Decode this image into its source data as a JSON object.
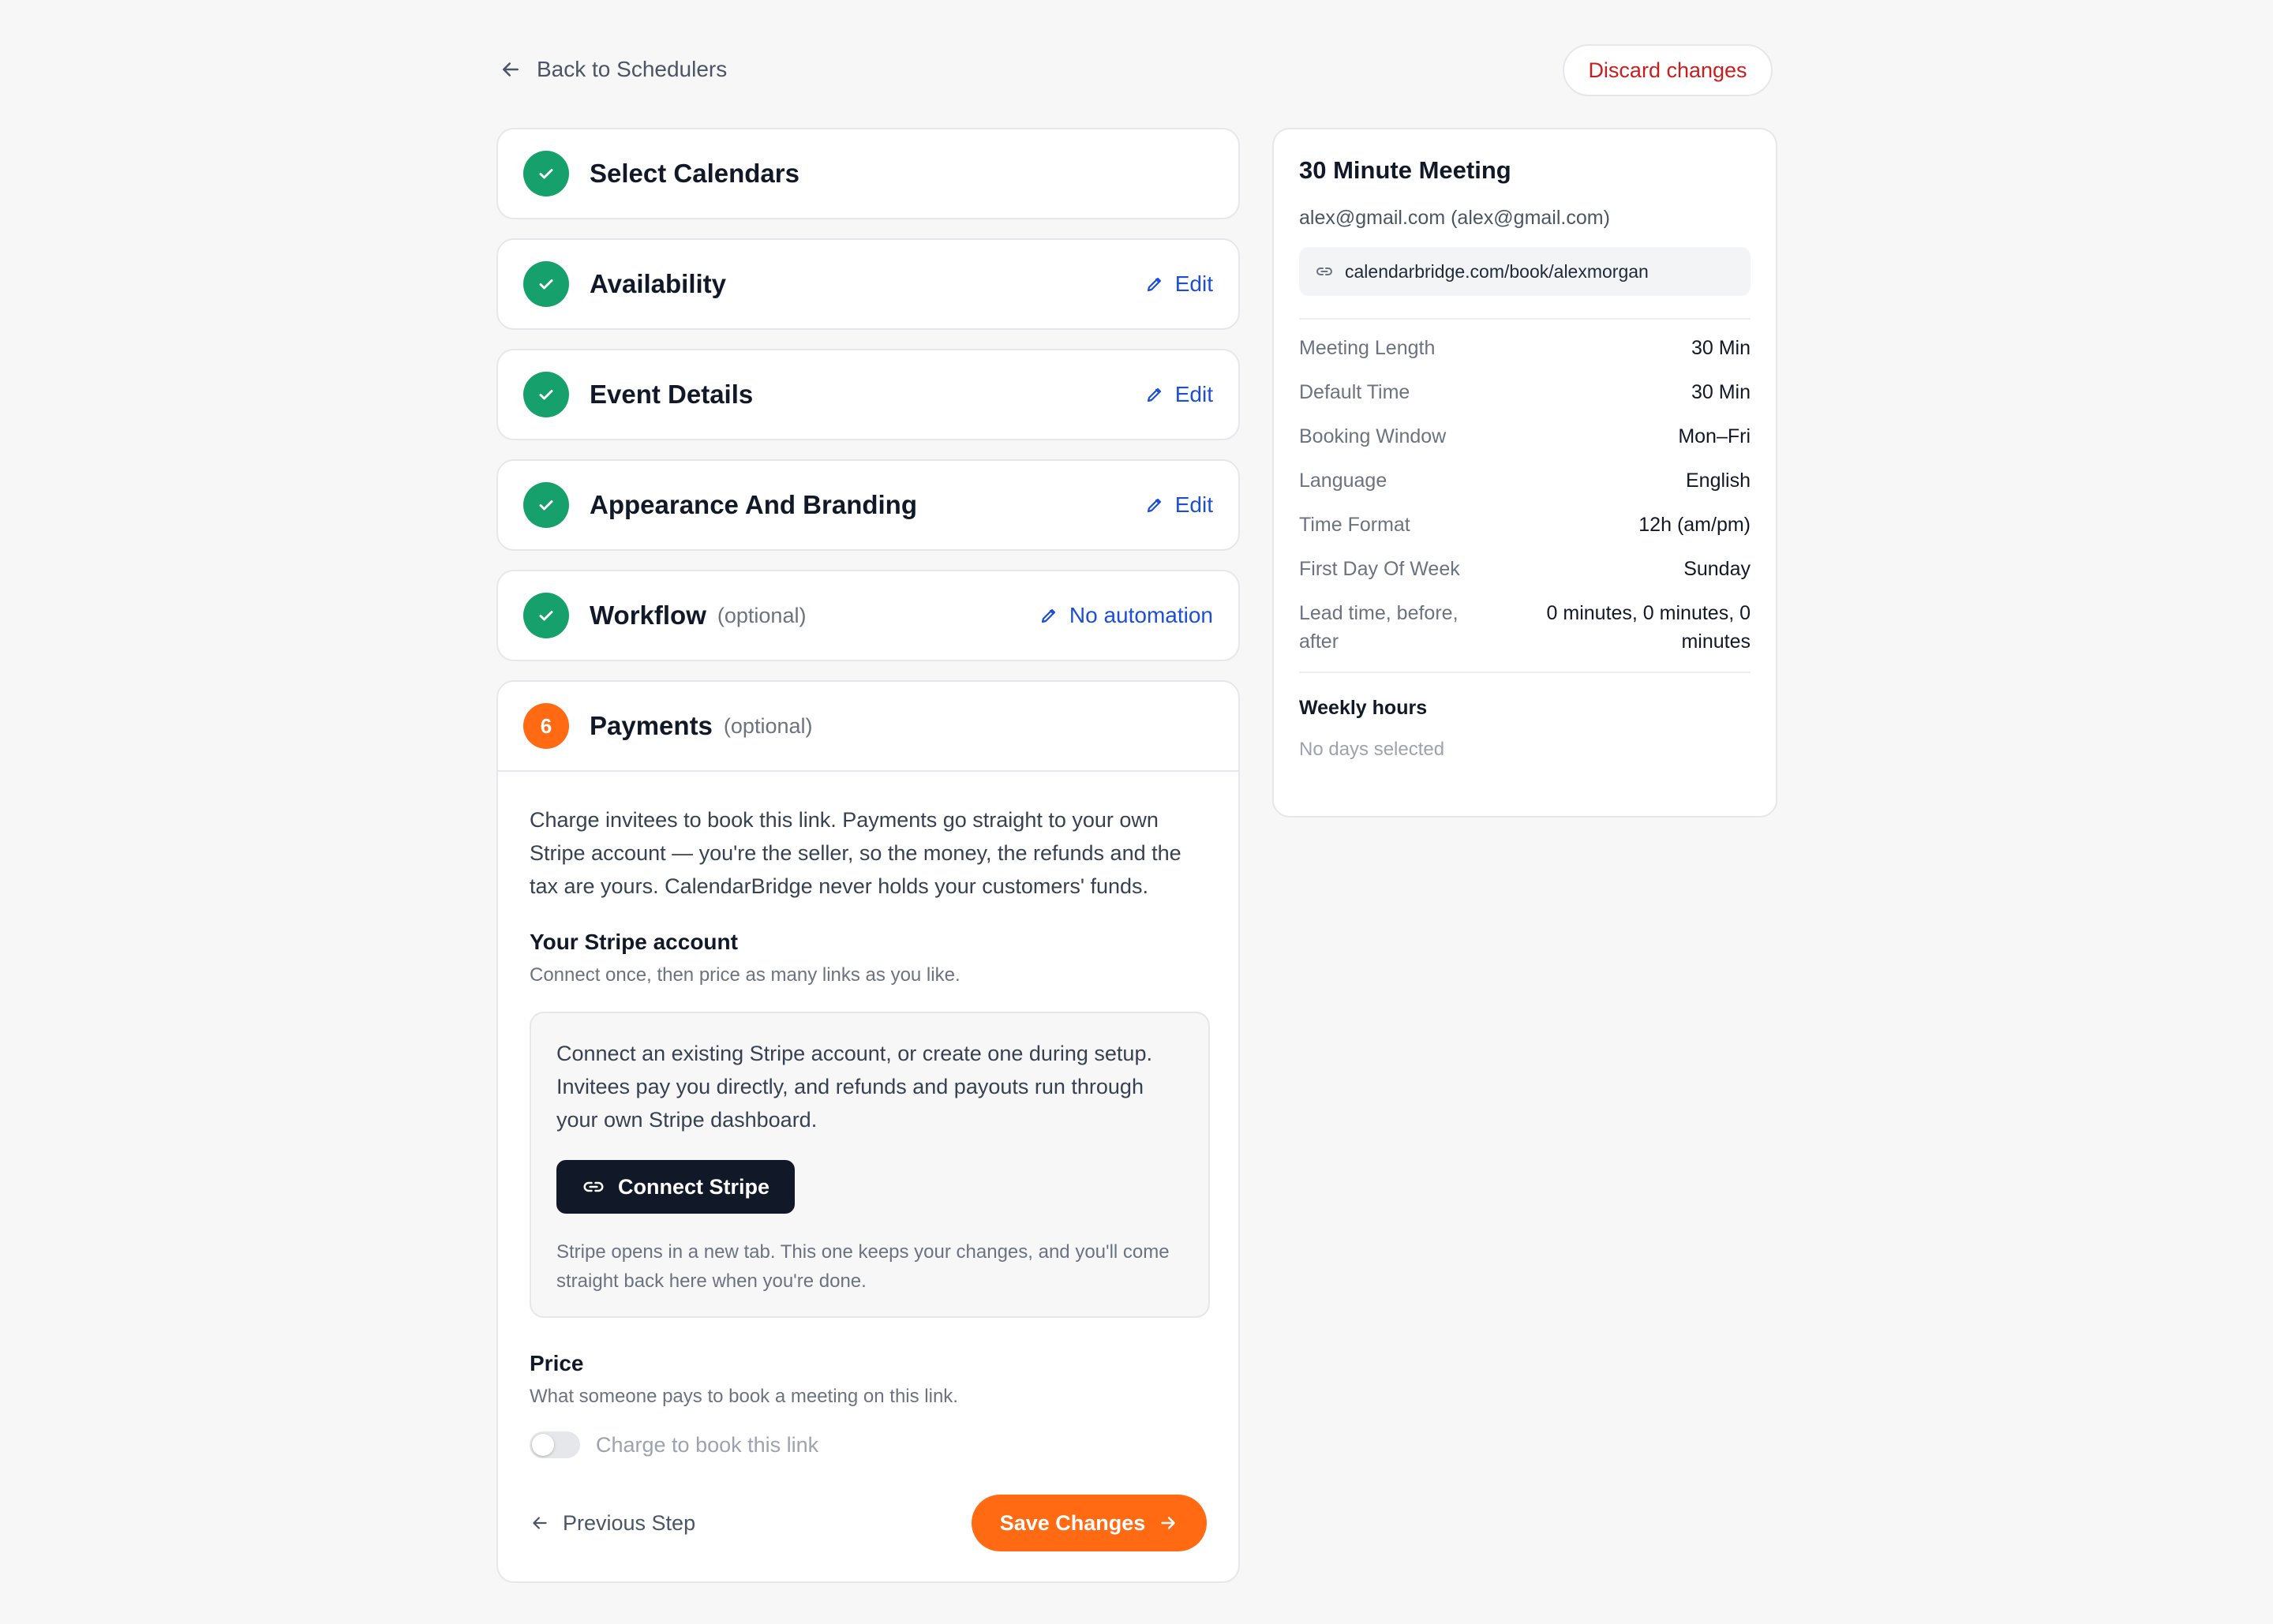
{
  "nav": {
    "back_label": "Back to Schedulers",
    "discard_label": "Discard changes"
  },
  "steps": [
    {
      "title": "Select Calendars",
      "optional": "",
      "action": "",
      "status": "complete"
    },
    {
      "title": "Availability",
      "optional": "",
      "action": "Edit",
      "status": "complete"
    },
    {
      "title": "Event Details",
      "optional": "",
      "action": "Edit",
      "status": "complete"
    },
    {
      "title": "Appearance And Branding",
      "optional": "",
      "action": "Edit",
      "status": "complete"
    },
    {
      "title": "Workflow",
      "optional": "(optional)",
      "action": "No automation",
      "status": "complete"
    }
  ],
  "payments": {
    "step_number": "6",
    "title": "Payments",
    "optional": "(optional)",
    "intro": "Charge invitees to book this link. Payments go straight to your own Stripe account — you're the seller, so the money, the refunds and the tax are yours. CalendarBridge never holds your customers' funds.",
    "stripe_title": "Your Stripe account",
    "stripe_sub": "Connect once, then price as many links as you like.",
    "stripe_box_text": "Connect an existing Stripe account, or create one during setup. Invitees pay you directly, and refunds and payouts run through your own Stripe dashboard.",
    "connect_label": "Connect Stripe",
    "stripe_note": "Stripe opens in a new tab. This one keeps your changes, and you'll come straight back here when you're done.",
    "price_title": "Price",
    "price_sub": "What someone pays to book a meeting on this link.",
    "charge_toggle_label": "Charge to book this link",
    "charge_enabled": false,
    "prev_label": "Previous Step",
    "save_label": "Save Changes"
  },
  "summary": {
    "title": "30 Minute Meeting",
    "email": "alex@gmail.com (alex@gmail.com)",
    "link": "calendarbridge.com/book/alexmorgan",
    "rows": [
      {
        "key": "Meeting Length",
        "value": "30 Min"
      },
      {
        "key": "Default Time",
        "value": "30 Min"
      },
      {
        "key": "Booking Window",
        "value": "Mon–Fri"
      },
      {
        "key": "Language",
        "value": "English"
      },
      {
        "key": "Time Format",
        "value": "12h (am/pm)"
      },
      {
        "key": "First Day Of Week",
        "value": "Sunday"
      },
      {
        "key": "Lead time, before, after",
        "value": "0 minutes, 0 minutes, 0 minutes"
      }
    ],
    "weekly_title": "Weekly hours",
    "weekly_value": "No days selected"
  },
  "colors": {
    "accent": "#ff6a13",
    "success": "#16a06c",
    "link": "#1d4ed8",
    "danger": "#c81e1e",
    "dark": "#111827"
  },
  "icons": {
    "back": "arrow-left-icon",
    "check": "check-icon",
    "edit": "pencil-icon",
    "link": "link-icon",
    "save": "arrow-right-icon"
  }
}
